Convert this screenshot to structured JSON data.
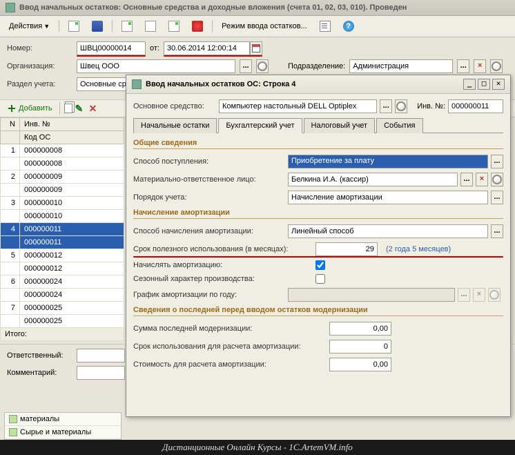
{
  "window_title": "Ввод начальных остатков: Основные средства и доходные вложения (счета 01, 02, 03, 010). Проведен",
  "toolbar": {
    "actions": "Действия",
    "mode": "Режим ввода остатков..."
  },
  "header": {
    "number_lbl": "Номер:",
    "number": "ШВЦ00000014",
    "from_lbl": "от:",
    "date": "30.06.2014 12:00:14",
    "org_lbl": "Организация:",
    "org": "Швец ООО",
    "dept_lbl": "Подразделение:",
    "dept": "Администрация",
    "section_lbl": "Раздел учета:",
    "section": "Основные средс"
  },
  "grid_toolbar": {
    "add": "Добавить"
  },
  "grid": {
    "col_n": "N",
    "col_inv": "Инв. №",
    "col_code": "Код ОС",
    "rows": [
      {
        "n": "1",
        "a": "000000008",
        "b": "000000008"
      },
      {
        "n": "2",
        "a": "000000009",
        "b": "000000009"
      },
      {
        "n": "3",
        "a": "000000010",
        "b": "000000010"
      },
      {
        "n": "4",
        "a": "000000011",
        "b": "000000011"
      },
      {
        "n": "5",
        "a": "000000012",
        "b": "000000012"
      },
      {
        "n": "6",
        "a": "000000024",
        "b": "000000024"
      },
      {
        "n": "7",
        "a": "000000025",
        "b": "000000025"
      }
    ],
    "total_lbl": "Итого:"
  },
  "footer": {
    "resp_lbl": "Ответственный:",
    "comment_lbl": "Комментарий:"
  },
  "bottom_list": {
    "r1": "материалы",
    "r2": "Сырье и материалы"
  },
  "dialog": {
    "title": "Ввод начальных остатков ОС: Строка 4",
    "asset_lbl": "Основное средство:",
    "asset": "Компьютер настольный DELL Optiplex",
    "inv_lbl": "Инв. №:",
    "inv": "000000011",
    "tabs": [
      "Начальные остатки",
      "Бухгалтерский учет",
      "Налоговый учет",
      "События"
    ],
    "sec1": "Общие сведения",
    "method_lbl": "Способ поступления:",
    "method": "Приобретение за плату",
    "mol_lbl": "Материально-ответственное лицо:",
    "mol": "Белкина И.А. (кассир)",
    "order_lbl": "Порядок учета:",
    "order": "Начисление амортизации",
    "sec2": "Начисление амортизации",
    "amort_method_lbl": "Способ начисления амортизации:",
    "amort_method": "Линейный способ",
    "life_lbl": "Срок полезного использования (в месяцах):",
    "life": "29",
    "life_hint": "(2 года 5 месяцев)",
    "do_amort_lbl": "Начислять амортизацию:",
    "seasonal_lbl": "Сезонный характер производства:",
    "graph_lbl": "График амортизации по году:",
    "sec3": "Сведения о последней перед вводом остатков модернизации",
    "last_sum_lbl": "Сумма последней модернизации:",
    "last_sum": "0,00",
    "last_life_lbl": "Срок использования для расчета амортизации:",
    "last_life": "0",
    "last_cost_lbl": "Стоимость для расчета амортизации:",
    "last_cost": "0,00"
  },
  "watermark": "Дистанционные Онлайн Курсы - 1C.ArtemVM.info"
}
